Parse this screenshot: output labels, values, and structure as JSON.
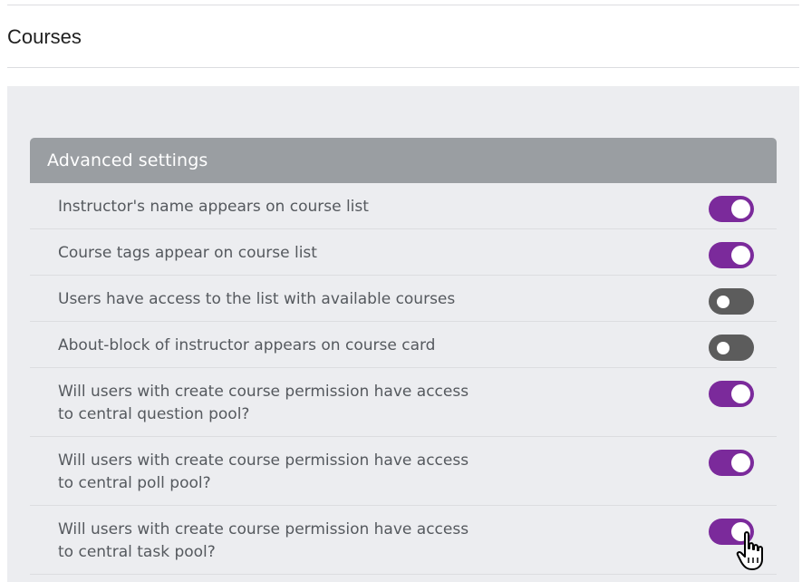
{
  "page": {
    "title": "Courses"
  },
  "card": {
    "header": "Advanced settings",
    "settings": [
      {
        "label": "Instructor's name appears on course list",
        "enabled": true
      },
      {
        "label": "Course tags appear on course list",
        "enabled": true
      },
      {
        "label": "Users have access to the list with available courses",
        "enabled": false
      },
      {
        "label": "About-block of instructor appears on course card",
        "enabled": false
      },
      {
        "label": "Will users with create course permission have access to central question pool?",
        "enabled": true
      },
      {
        "label": "Will users with create course permission have access to central poll pool?",
        "enabled": true
      },
      {
        "label": "Will users with create course permission have access to central task pool?",
        "enabled": true
      }
    ]
  },
  "colors": {
    "toggle_on": "#7b2a9b",
    "toggle_off": "#5c5c5c",
    "header_bg": "#9a9ea2",
    "panel_bg": "#ecedf0"
  },
  "icons": {
    "cursor": "hand-pointer-icon"
  }
}
